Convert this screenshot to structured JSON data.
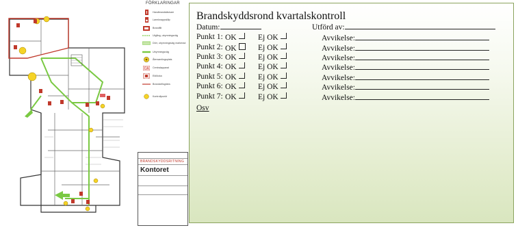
{
  "legend": {
    "title": "FÖRKLARINGAR",
    "items": [
      {
        "label": "Handbrandsläckare",
        "icon": "fire-extinguisher-icon"
      },
      {
        "label": "Larmknappskåp",
        "icon": "alarm-cabinet-icon"
      },
      {
        "label": "Brandfilt",
        "icon": "fire-blanket-icon"
      },
      {
        "label": "Utgång, utrymningsväg",
        "icon": "exit-route-line-icon"
      },
      {
        "label": "Dörr, utrymningsväg markerad",
        "icon": "exit-door-icon"
      },
      {
        "label": "Utrymningsväg",
        "icon": "evacuation-route-icon"
      },
      {
        "label": "Återsamlingsplats",
        "icon": "assembly-point-icon"
      },
      {
        "label": "Centralapparat",
        "icon": "central-unit-icon"
      },
      {
        "label": "Eldlöcka",
        "icon": "fire-hatch-icon"
      },
      {
        "label": "Brandcellsgräns",
        "icon": "fire-cell-boundary-icon"
      },
      {
        "label": "Kontrollpunkt",
        "icon": "checkpoint-icon"
      }
    ]
  },
  "titleblock": {
    "heading": "BRANDSKYDDSRITNING",
    "name": "Kontoret"
  },
  "checklist": {
    "title": "Brandskyddsrond kvartalskontroll",
    "date_label": "Datum:",
    "performed_by_label": "Utförd av:",
    "ok_label": "OK",
    "not_ok_label": "Ej OK",
    "deviation_label": "Avvikelse:",
    "points": [
      {
        "label": "Punkt 1:"
      },
      {
        "label": "Punkt 2:"
      },
      {
        "label": "Punkt 3:"
      },
      {
        "label": "Punkt 4:"
      },
      {
        "label": "Punkt 5:"
      },
      {
        "label": "Punkt 6:"
      },
      {
        "label": "Punkt 7:"
      }
    ],
    "footer": "Osv"
  },
  "colors": {
    "route_green": "#7ac943",
    "marker_yellow": "#f5d327",
    "alarm_red": "#c0392b",
    "panel_border": "#8aa35d"
  }
}
